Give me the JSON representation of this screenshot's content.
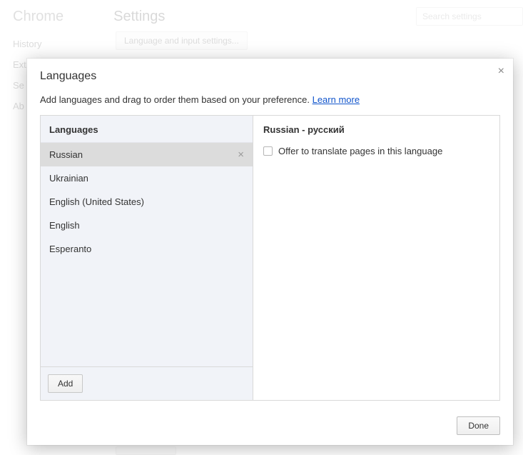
{
  "bg": {
    "app_name": "Chrome",
    "page_title": "Settings",
    "search_placeholder": "Search settings",
    "sidebar": {
      "items": [
        "History",
        "Ext",
        "Se",
        "",
        "Ab"
      ]
    },
    "lang_button": "Language and input settings..."
  },
  "modal": {
    "title": "Languages",
    "subtitle_text": "Add languages and drag to order them based on your preference. ",
    "learn_more": "Learn more",
    "close_glyph": "×",
    "left_header": "Languages",
    "languages": [
      {
        "label": "Russian",
        "selected": true
      },
      {
        "label": "Ukrainian",
        "selected": false
      },
      {
        "label": "English (United States)",
        "selected": false
      },
      {
        "label": "English",
        "selected": false
      },
      {
        "label": "Esperanto",
        "selected": false
      }
    ],
    "remove_glyph": "×",
    "add_label": "Add",
    "right_header": "Russian - русский",
    "translate_label": "Offer to translate pages in this language",
    "done_label": "Done"
  }
}
